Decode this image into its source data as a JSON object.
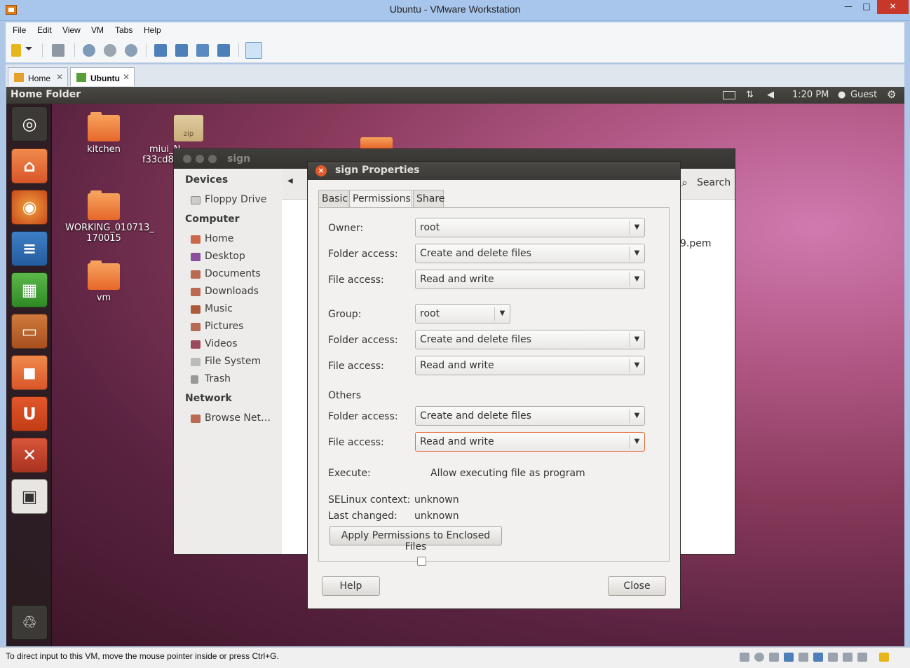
{
  "window": {
    "title": "Ubuntu - VMware Workstation",
    "minimize": "—",
    "maximize": "□",
    "close": "✕"
  },
  "menu": [
    "File",
    "Edit",
    "View",
    "VM",
    "Tabs",
    "Help"
  ],
  "tabs": [
    {
      "label": "Home",
      "close": "✕"
    },
    {
      "label": "Ubuntu",
      "close": "✕"
    }
  ],
  "guest": {
    "topbar": {
      "title": "Home Folder",
      "time": "1:20 PM",
      "user": "Guest",
      "icons": [
        "mail-icon",
        "network-icon",
        "volume-icon",
        "user-icon",
        "gear-icon"
      ]
    },
    "launcher_icons": [
      "dash-icon",
      "home-folder-icon",
      "firefox-icon",
      "writer-icon",
      "calc-icon",
      "impress-icon",
      "software-center-icon",
      "ubuntu-one-icon",
      "system-settings-icon",
      "workspace-switcher-icon",
      "trash-icon"
    ],
    "desktop_icons": [
      {
        "label": "kitchen"
      },
      {
        "label": "miui_N",
        "sub": "f33cd8",
        "badge": "zip"
      },
      {
        "label": "WORKING_010713_",
        "sub": "170015"
      },
      {
        "label": "vm"
      }
    ]
  },
  "nautilus": {
    "title": "sign",
    "search": "Search",
    "partial_file": "9.pem",
    "sidebar": {
      "devices_header": "Devices",
      "devices": [
        "Floppy Drive"
      ],
      "computer_header": "Computer",
      "computer": [
        "Home",
        "Desktop",
        "Documents",
        "Downloads",
        "Music",
        "Pictures",
        "Videos",
        "File System",
        "Trash"
      ],
      "network_header": "Network",
      "network": [
        "Browse Net…"
      ]
    }
  },
  "dialog": {
    "title": "sign Properties",
    "tabs": [
      "Basic",
      "Permissions",
      "Share"
    ],
    "active_tab": "Permissions",
    "owner": {
      "label": "Owner:",
      "value": "root",
      "folder_label": "Folder access:",
      "folder_value": "Create and delete files",
      "file_label": "File access:",
      "file_value": "Read and write"
    },
    "group": {
      "label": "Group:",
      "value": "root",
      "folder_label": "Folder access:",
      "folder_value": "Create and delete files",
      "file_label": "File access:",
      "file_value": "Read and write"
    },
    "others": {
      "header": "Others",
      "folder_label": "Folder access:",
      "folder_value": "Create and delete files",
      "file_label": "File access:",
      "file_value": "Read and write"
    },
    "execute": {
      "label": "Execute:",
      "checkbox": "Allow executing file as program",
      "checked": false
    },
    "selinux": {
      "label": "SELinux context:",
      "value": "unknown"
    },
    "last_changed": {
      "label": "Last changed:",
      "value": "unknown"
    },
    "apply_button": "Apply Permissions to Enclosed Files",
    "help_button": "Help",
    "close_button": "Close"
  },
  "statusbar": {
    "text": "To direct input to this VM, move the mouse pointer inside or press Ctrl+G."
  }
}
